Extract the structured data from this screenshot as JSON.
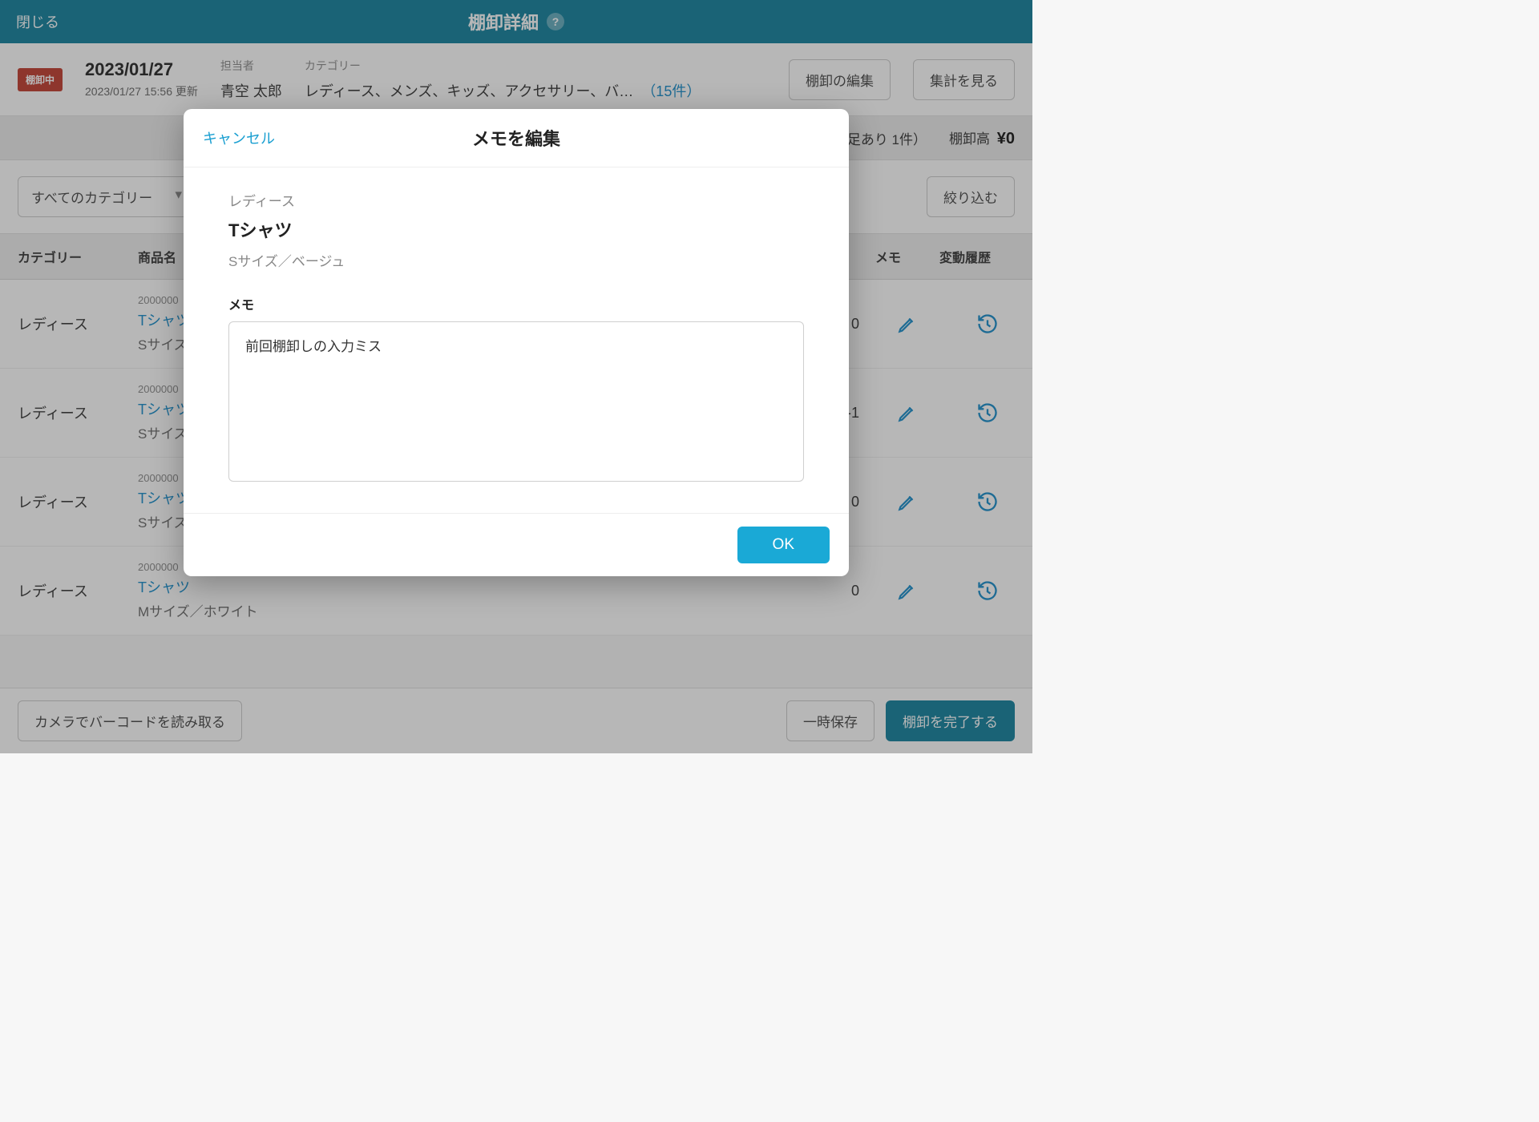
{
  "topbar": {
    "close": "閉じる",
    "title": "棚卸詳細"
  },
  "info": {
    "badge": "棚卸中",
    "date": "2023/01/27",
    "updated": "2023/01/27 15:56 更新",
    "staff_label": "担当者",
    "staff": "青空 太郎",
    "category_label": "カテゴリー",
    "categories": "レディース、メンズ、キッズ、アクセサリー、バ…",
    "count": "（15件）",
    "edit_btn": "棚卸の編集",
    "summary_btn": "集計を見る"
  },
  "stats": {
    "short": "足あり 1件）",
    "total_label": "棚卸高",
    "total_value": "¥0"
  },
  "filter": {
    "all_categories": "すべてのカテゴリー",
    "narrow": "絞り込む"
  },
  "columns": {
    "category": "カテゴリー",
    "name": "商品名",
    "c3": "",
    "c4": "",
    "c5": "",
    "diff": "",
    "memo": "メモ",
    "history": "変動履歴"
  },
  "rows": [
    {
      "cat": "レディース",
      "sku": "2000000",
      "name": "Tシャツ",
      "variant": "Sサイズ",
      "diff": "0"
    },
    {
      "cat": "レディース",
      "sku": "2000000",
      "name": "Tシャツ",
      "variant": "Sサイズ",
      "diff": "-1"
    },
    {
      "cat": "レディース",
      "sku": "2000000",
      "name": "Tシャツ",
      "variant": "Sサイズ",
      "diff": "0"
    },
    {
      "cat": "レディース",
      "sku": "2000000",
      "name": "Tシャツ",
      "variant": "Mサイズ／ホワイト",
      "diff": "0"
    }
  ],
  "bottom": {
    "barcode": "カメラでバーコードを読み取る",
    "save": "一時保存",
    "complete": "棚卸を完了する"
  },
  "modal": {
    "cancel": "キャンセル",
    "title": "メモを編集",
    "category": "レディース",
    "product": "Tシャツ",
    "variant": "Sサイズ／ベージュ",
    "memo_label": "メモ",
    "memo_value": "前回棚卸しの入力ミス",
    "ok": "OK"
  }
}
